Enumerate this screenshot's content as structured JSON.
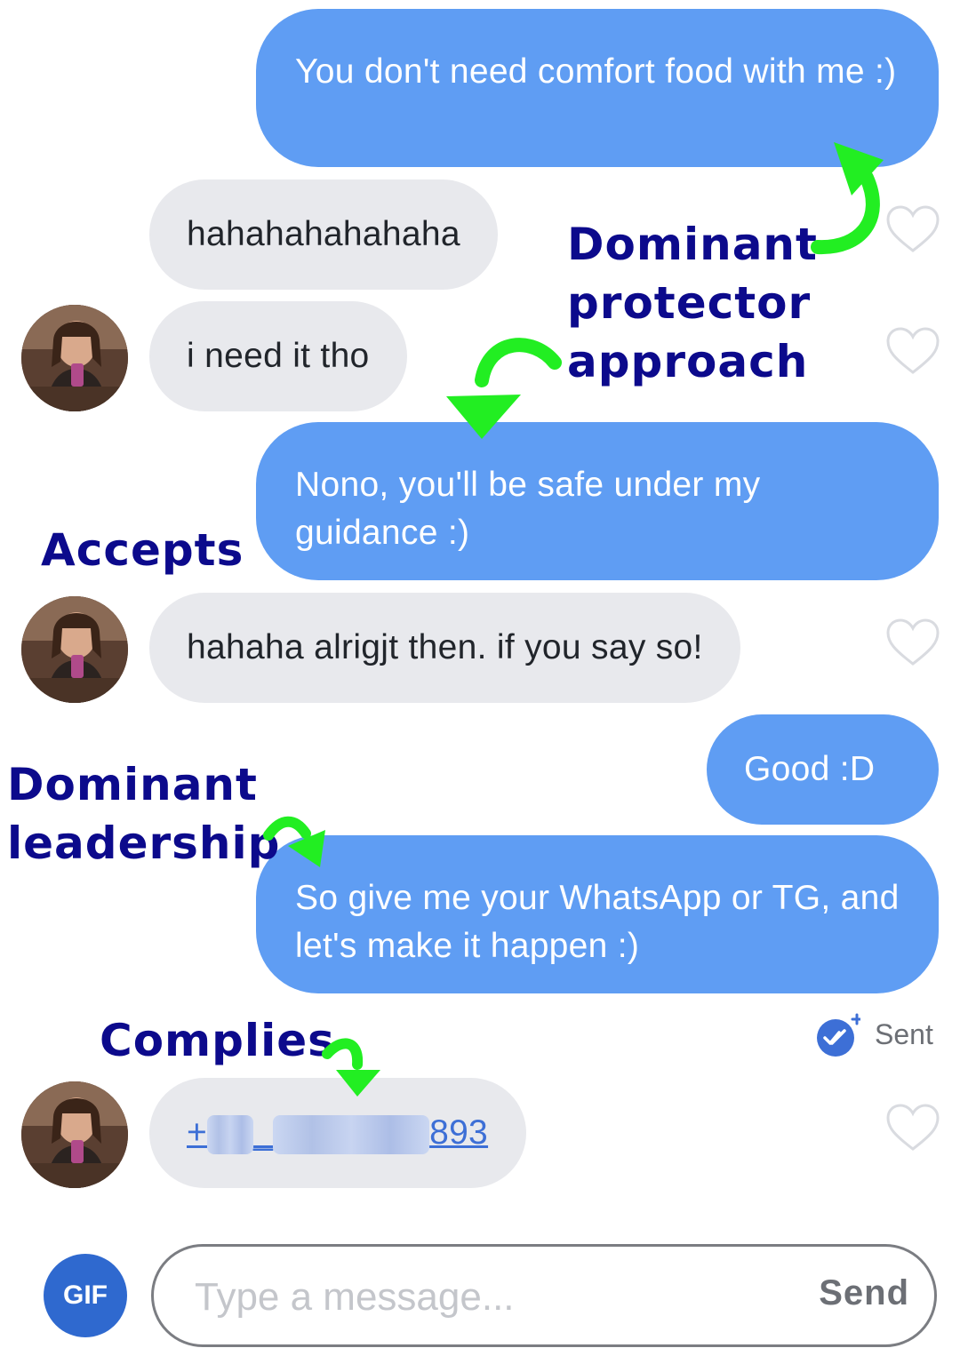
{
  "messages": [
    {
      "dir": "out",
      "text": "You don't need comfort food with me :)"
    },
    {
      "dir": "in",
      "text": "hahahahahahaha"
    },
    {
      "dir": "in",
      "text": "i need it tho"
    },
    {
      "dir": "out",
      "text": "Nono, you'll be safe under my guidance :)"
    },
    {
      "dir": "in",
      "text": "hahaha alrigjt then. if you say so!"
    },
    {
      "dir": "out",
      "text": "Good :D"
    },
    {
      "dir": "out",
      "text": "So give me your WhatsApp or TG, and let's make it happen :)"
    },
    {
      "dir": "in",
      "phone_prefix": "+",
      "phone_suffix": "893"
    }
  ],
  "status": {
    "sent_label": "Sent"
  },
  "annotations": {
    "dominant_protector": [
      "Dominant",
      "protector",
      "approach"
    ],
    "accepts": "Accepts",
    "dominant_leadership": [
      "Dominant",
      "leadership"
    ],
    "complies": "Complies"
  },
  "composer": {
    "gif_label": "GIF",
    "placeholder": "Type a message...",
    "send_label": "Send"
  },
  "colors": {
    "outgoing_bubble": "#5f9df3",
    "incoming_bubble": "#e8e9ed",
    "annotation_text": "#0c0a8c",
    "annotation_arrow": "#22ee22",
    "gif_button": "#2f69cf"
  }
}
